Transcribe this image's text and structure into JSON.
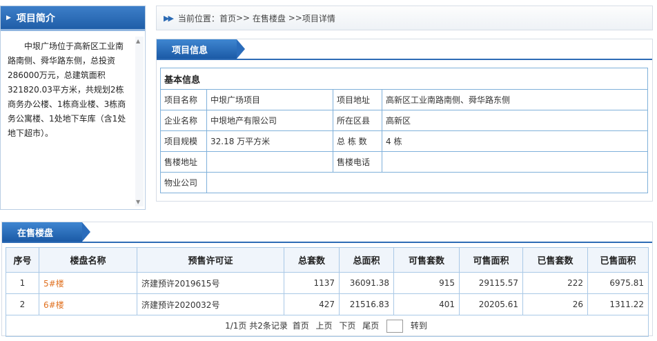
{
  "intro": {
    "title": "项目简介",
    "text": "中垠广场位于高新区工业南路南侧、舜华路东侧，总投资286000万元，总建筑面积321820.03平方米，共规划2栋商务办公楼、1栋商业楼、3栋商务公寓楼、1处地下车库（含1处地下超市）。"
  },
  "breadcrumb": {
    "prefix": "当前位置：",
    "home": "首页",
    "sep1": ">>",
    "onsale": "在售楼盘",
    "sep2": ">>",
    "current": "项目详情"
  },
  "info": {
    "section_title": "项目信息",
    "caption": "基本信息",
    "rows": [
      {
        "l1": "项目名称",
        "v1": "中垠广场项目",
        "l2": "项目地址",
        "v2": "高新区工业南路南侧、舜华路东侧"
      },
      {
        "l1": "企业名称",
        "v1": "中垠地产有限公司",
        "l2": "所在区县",
        "v2": "高新区"
      },
      {
        "l1": "项目规模",
        "v1": "32.18 万平方米",
        "l2": "总 栋 数",
        "v2": "4 栋"
      },
      {
        "l1": "售楼地址",
        "v1": "",
        "l2": "售楼电话",
        "v2": ""
      },
      {
        "l1": "物业公司",
        "v1": ""
      }
    ]
  },
  "sale": {
    "section_title": "在售楼盘",
    "headers": [
      "序号",
      "楼盘名称",
      "预售许可证",
      "总套数",
      "总面积",
      "可售套数",
      "可售面积",
      "已售套数",
      "已售面积"
    ],
    "rows": [
      {
        "no": "1",
        "name": "5#楼",
        "permit": "济建预许2019615号",
        "total_units": "1137",
        "total_area": "36091.38",
        "avail_units": "915",
        "avail_area": "29115.57",
        "sold_units": "222",
        "sold_area": "6975.81"
      },
      {
        "no": "2",
        "name": "6#楼",
        "permit": "济建预许2020032号",
        "total_units": "427",
        "total_area": "21516.83",
        "avail_units": "401",
        "avail_area": "20205.61",
        "sold_units": "26",
        "sold_area": "1311.22"
      }
    ],
    "pager": {
      "summary": "1/1页 共2条记录",
      "first": "首页",
      "prev": "上页",
      "next": "下页",
      "last": "尾页",
      "go": "转到"
    }
  },
  "colors": {
    "primary_blue": "#1f5ea8",
    "border_blue": "#7fb0da",
    "link_orange": "#e0701f"
  }
}
